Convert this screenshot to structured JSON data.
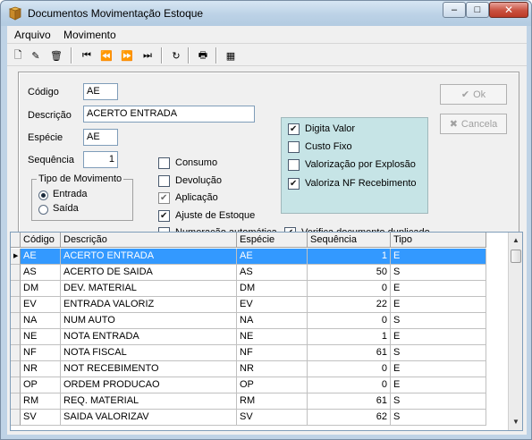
{
  "window": {
    "title": "Documentos Movimentação Estoque",
    "close_glyph": "✕",
    "minimize_glyph": "–",
    "maximize_glyph": "□"
  },
  "menu": [
    "Arquivo",
    "Movimento"
  ],
  "toolbar": {
    "icons": [
      "new-document-icon",
      "edit-icon",
      "delete-icon",
      "first-record-icon",
      "previous-record-icon",
      "next-record-icon",
      "last-record-icon",
      "refresh-icon",
      "print-icon",
      "settings-icon"
    ],
    "glyphs": [
      "🗋",
      "✎",
      "🗑",
      "⏮",
      "⏪",
      "⏩",
      "⏭",
      "↻",
      "🖶",
      "▦"
    ]
  },
  "form": {
    "codigo_label": "Código",
    "codigo_value": "AE",
    "descricao_label": "Descrição",
    "descricao_value": "ACERTO ENTRADA",
    "especie_label": "Espécie",
    "especie_value": "AE",
    "sequencia_label": "Sequência",
    "sequencia_value": "1",
    "tipo_group_title": "Tipo de Movimento",
    "tipo_entrada": "Entrada",
    "tipo_saida": "Saída",
    "tipo_selected": "Entrada",
    "checks_left": [
      {
        "label": "Consumo",
        "checked": false,
        "disabled": false
      },
      {
        "label": "Devolução",
        "checked": false,
        "disabled": false
      },
      {
        "label": "Aplicação",
        "checked": true,
        "disabled": true
      },
      {
        "label": "Ajuste de Estoque",
        "checked": true,
        "disabled": false
      },
      {
        "label": "Numeração automática",
        "checked": false,
        "disabled": false
      }
    ],
    "checks_right": [
      {
        "label": "Digita Valor",
        "checked": true
      },
      {
        "label": "Custo Fixo",
        "checked": false
      },
      {
        "label": "Valorização por Explosão",
        "checked": false
      },
      {
        "label": "Valoriza NF Recebimento",
        "checked": true
      }
    ],
    "verifica_label": "Verifica documento duplicado",
    "verifica_checked": true,
    "ok_label": "Ok",
    "cancel_label": "Cancela",
    "highlight_color": "#c6e4e6"
  },
  "grid": {
    "columns": [
      "Código",
      "Descrição",
      "Espécie",
      "Sequência",
      "Tipo"
    ],
    "selected_row": 0,
    "rows": [
      [
        "AE",
        "ACERTO ENTRADA",
        "AE",
        "1",
        "E"
      ],
      [
        "AS",
        "ACERTO DE SAIDA",
        "AS",
        "50",
        "S"
      ],
      [
        "DM",
        "DEV. MATERIAL",
        "DM",
        "0",
        "E"
      ],
      [
        "EV",
        "ENTRADA VALORIZ",
        "EV",
        "22",
        "E"
      ],
      [
        "NA",
        "NUM AUTO",
        "NA",
        "0",
        "S"
      ],
      [
        "NE",
        "NOTA ENTRADA",
        "NE",
        "1",
        "E"
      ],
      [
        "NF",
        "NOTA FISCAL",
        "NF",
        "61",
        "S"
      ],
      [
        "NR",
        "NOT RECEBIMENTO",
        "NR",
        "0",
        "E"
      ],
      [
        "OP",
        "ORDEM PRODUCAO",
        "OP",
        "0",
        "E"
      ],
      [
        "RM",
        "REQ. MATERIAL",
        "RM",
        "61",
        "S"
      ],
      [
        "SV",
        "SAIDA VALORIZAV",
        "SV",
        "62",
        "S"
      ]
    ],
    "selection_color": "#3399ff"
  }
}
